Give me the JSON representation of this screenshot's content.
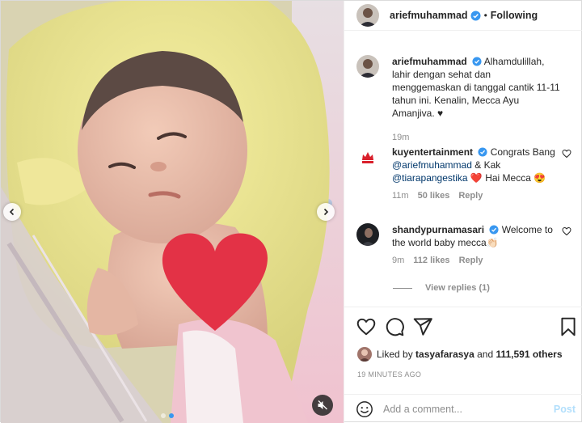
{
  "post": {
    "author": "ariefmuhammad",
    "follow_status": "Following",
    "separator": "•",
    "caption": {
      "author": "ariefmuhammad",
      "text": "Alhamdulillah, lahir dengan sehat dan menggemaskan di tanggal cantik 11-11 tahun ini. Kenalin, Mecca Ayu Amanjiva. ♥",
      "time": "19m"
    },
    "comments": [
      {
        "author": "kuyentertainment",
        "text_before": "Congrats Bang ",
        "mention1": "@ariefmuhammad",
        "text_mid": " & Kak ",
        "mention2": "@tiarapangestika",
        "text_after": " ❤️ Hai Mecca 😍",
        "time": "11m",
        "likes": "50 likes",
        "reply": "Reply"
      },
      {
        "author": "shandypurnamasari",
        "text": "Welcome to the world baby mecca👏🏻",
        "time": "9m",
        "likes": "112 likes",
        "reply": "Reply",
        "view_replies": "View replies (1)"
      }
    ],
    "liked_by_prefix": "Liked by ",
    "liked_by_user": "tasyafarasya",
    "liked_by_and": " and ",
    "liked_by_count": "111,591 others",
    "posted_time": "19 MINUTES AGO",
    "add_comment_placeholder": "Add a comment...",
    "post_label": "Post",
    "carousel": {
      "slides": 2,
      "active_slide": 1
    }
  },
  "icons": {
    "verified": "verified-badge-icon",
    "like": "heart-outline-icon",
    "comment": "speech-bubble-icon",
    "share": "paper-plane-icon",
    "save": "bookmark-icon",
    "emoji": "smiley-icon",
    "mute": "speaker-muted-icon",
    "prev": "chevron-left-icon",
    "next": "chevron-right-icon"
  },
  "colors": {
    "verified": "#3897f0",
    "mention": "#00376b",
    "secondary_text": "#8e8e8e",
    "post_button_disabled": "#b2dffc",
    "heart_overlay": "#e33246"
  }
}
